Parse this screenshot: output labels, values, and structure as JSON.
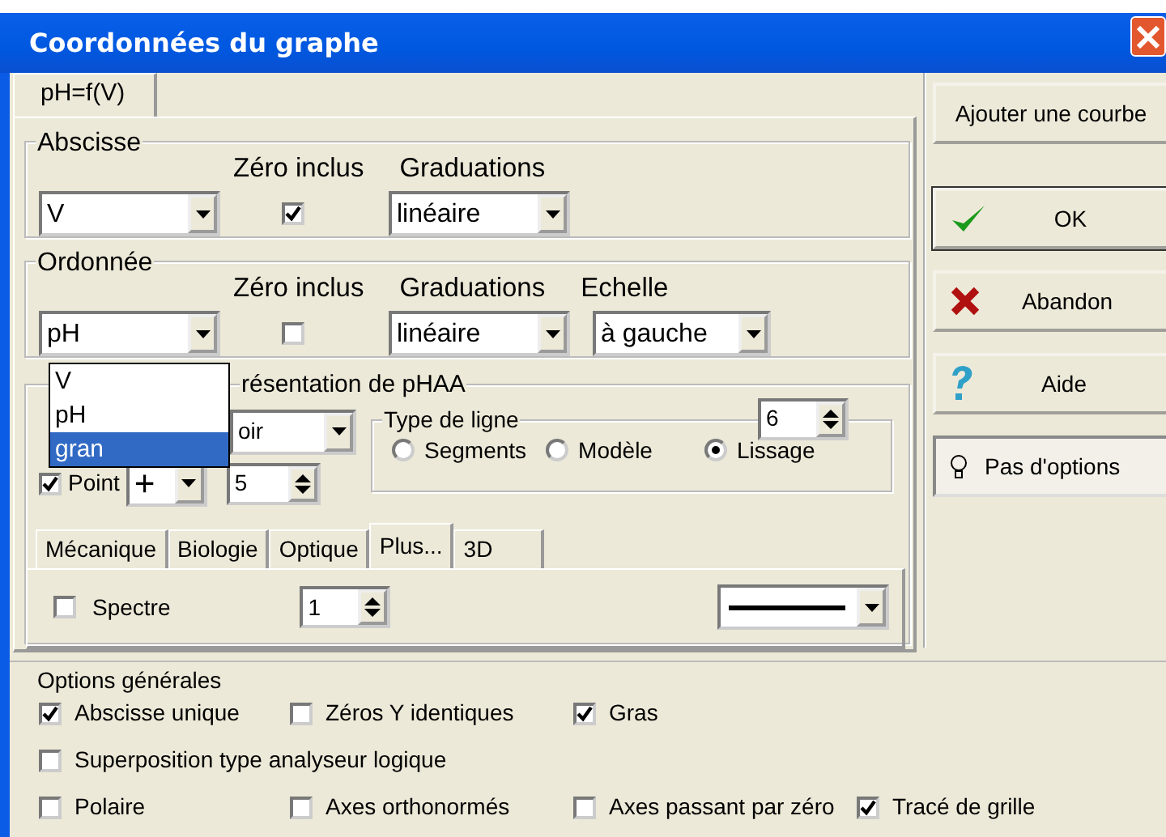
{
  "window": {
    "title": "Coordonnées du graphe"
  },
  "tabs": [
    {
      "label": "pH=f(V)",
      "selected": true
    }
  ],
  "abscisse": {
    "legend": "Abscisse",
    "headers": [
      "Zéro inclus",
      "Graduations"
    ],
    "variable": "V",
    "zero_inclus": true,
    "graduations": "linéaire"
  },
  "ordonnee": {
    "legend": "Ordonnée",
    "headers": [
      "Zéro inclus",
      "Graduations",
      "Echelle"
    ],
    "variable": "pH",
    "zero_inclus": false,
    "graduations": "linéaire",
    "echelle": "à gauche"
  },
  "dropdown": {
    "options": [
      {
        "label": "V",
        "selected": false
      },
      {
        "label": "pH",
        "selected": false
      },
      {
        "label": "gran",
        "selected": true
      }
    ]
  },
  "representation": {
    "legend": "résentation de pHAA",
    "style": "oir",
    "point": {
      "label": "Point",
      "checked": true,
      "symbol": "+",
      "size": "5"
    },
    "type_de_ligne": {
      "legend": "Type de ligne",
      "value": "6",
      "options": [
        {
          "label": "Segments",
          "selected": false
        },
        {
          "label": "Modèle",
          "selected": false
        },
        {
          "label": "Lissage",
          "selected": true
        }
      ]
    },
    "subtabs": [
      {
        "label": "Mécanique",
        "selected": false
      },
      {
        "label": "Biologie",
        "selected": false
      },
      {
        "label": "Optique",
        "selected": false
      },
      {
        "label": "Plus...",
        "selected": true
      },
      {
        "label": "3D",
        "selected": false
      }
    ],
    "spectre": {
      "label": "Spectre",
      "checked": false,
      "value": "1"
    }
  },
  "options_generales": {
    "legend": "Options générales",
    "rows": [
      [
        {
          "label": "Abscisse unique",
          "checked": true
        },
        {
          "label": "Zéros Y identiques",
          "checked": false
        },
        {
          "label": "Gras",
          "checked": true
        }
      ],
      [
        {
          "label": "Superposition type analyseur logique",
          "checked": false
        }
      ],
      [
        {
          "label": "Polaire",
          "checked": false
        },
        {
          "label": "Axes orthonormés",
          "checked": false
        },
        {
          "label": "Axes passant par zéro",
          "checked": false
        },
        {
          "label": "Tracé de grille",
          "checked": true
        }
      ]
    ]
  },
  "buttons": [
    {
      "label": "Ajouter une courbe",
      "kind": "plain"
    },
    {
      "label": "OK",
      "kind": "ok"
    },
    {
      "label": "Abandon",
      "kind": "cancel"
    },
    {
      "label": "Aide",
      "kind": "help"
    },
    {
      "label": "Pas d'options",
      "kind": "options"
    }
  ]
}
